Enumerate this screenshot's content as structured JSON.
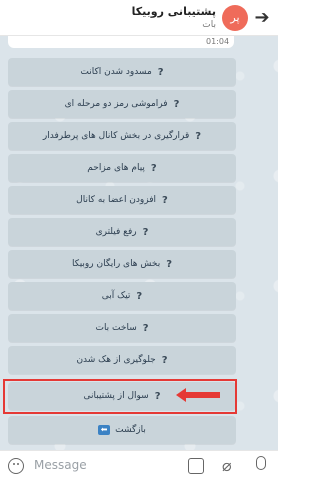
{
  "header": {
    "title": "پشتیبانی روبیکا",
    "subtitle": "بات",
    "avatar_text": "پر",
    "back_icon": "arrow-right-icon"
  },
  "chat": {
    "time": "01:04",
    "buttons": [
      {
        "label": "مسدود شدن اکانت",
        "marker": "?"
      },
      {
        "label": "فراموشی رمز دو مرحله ای",
        "marker": "?"
      },
      {
        "label": "قرارگیری در بخش کانال های پرطرفدار",
        "marker": "?"
      },
      {
        "label": "پیام های مزاحم",
        "marker": "?"
      },
      {
        "label": "افزودن اعضا به کانال",
        "marker": "?"
      },
      {
        "label": "رفع فیلتری",
        "marker": "?"
      },
      {
        "label": "بخش های رایگان روبیکا",
        "marker": "?"
      },
      {
        "label": "تیک آبی",
        "marker": "?"
      },
      {
        "label": "ساخت بات",
        "marker": "?"
      },
      {
        "label": "جلوگیری از هک شدن",
        "marker": "?"
      },
      {
        "label": "سوال از پشتیبانی",
        "marker": "?"
      }
    ],
    "back_button": {
      "label": "بازگشت",
      "icon": "back-arrow-icon"
    }
  },
  "composer": {
    "placeholder": "Message"
  },
  "colors": {
    "highlight": "#e53935",
    "avatar": "#ef6b5a",
    "chat_bg": "#dbe4ea",
    "button_bg": "#c9d4da"
  }
}
